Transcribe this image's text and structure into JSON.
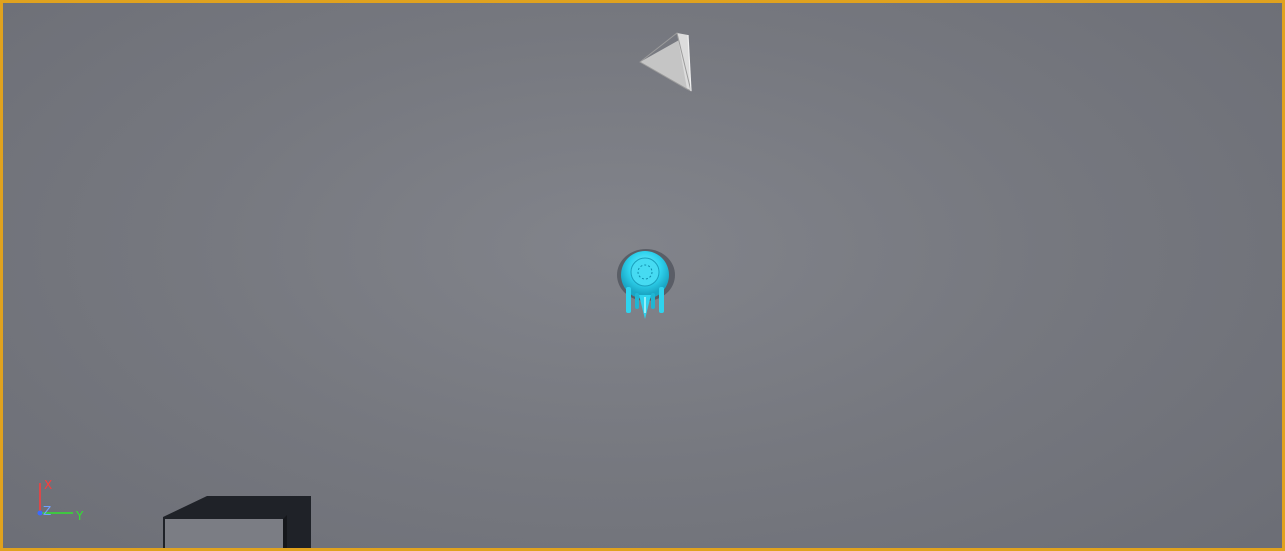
{
  "viewport": {
    "selection_outline_color": "#e0a21e",
    "background_color": "#76787f"
  },
  "scene": {
    "actors": [
      {
        "name": "camera-actor",
        "icon": "pyramid-camera-icon",
        "color": "#c9c9c9"
      },
      {
        "name": "player-ship",
        "icon": "spaceship-icon",
        "color": "#2fd3ee"
      },
      {
        "name": "floor-block",
        "icon": "dark-block-mesh",
        "color": "#22252b"
      }
    ]
  },
  "axis_gizmo": {
    "x_label": "X",
    "y_label": "Y",
    "z_label": "Z",
    "x_color": "#ff3b3b",
    "y_color": "#31e331",
    "z_color": "#3b6bff"
  }
}
